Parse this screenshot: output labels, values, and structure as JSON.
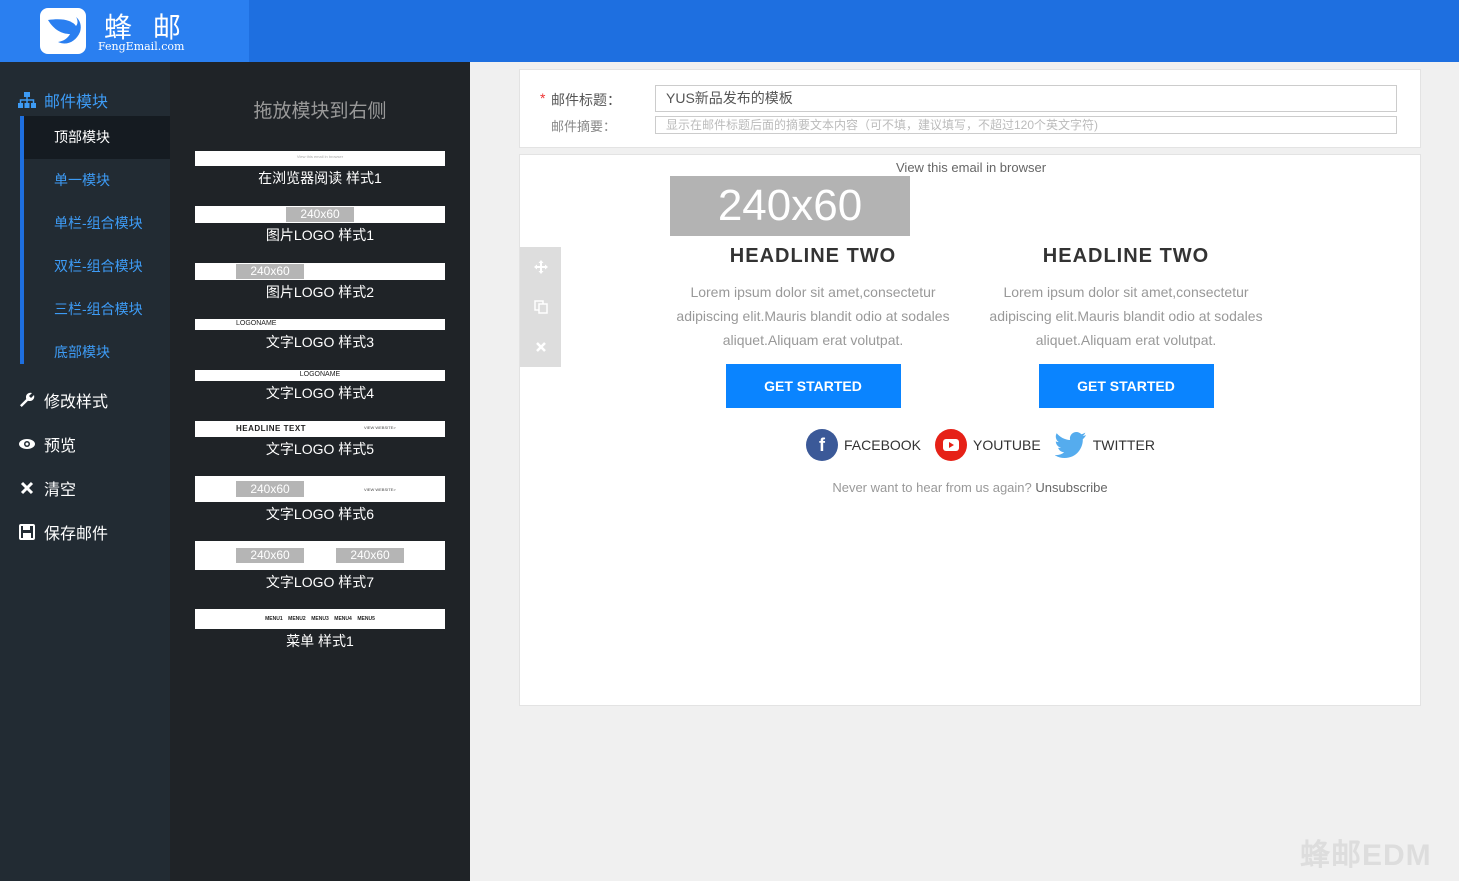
{
  "brand": {
    "name_cn": "蜂 邮",
    "name_en": "FengEmail.com"
  },
  "sidebar": {
    "section_label": "邮件模块",
    "sub_items": [
      {
        "label": "顶部模块",
        "active": true
      },
      {
        "label": "单一模块",
        "active": false
      },
      {
        "label": "单栏-组合模块",
        "active": false
      },
      {
        "label": "双栏-组合模块",
        "active": false
      },
      {
        "label": "三栏-组合模块",
        "active": false
      },
      {
        "label": "底部模块",
        "active": false
      }
    ],
    "actions": [
      {
        "label": "修改样式",
        "icon": "wrench-icon"
      },
      {
        "label": "预览",
        "icon": "eye-icon"
      },
      {
        "label": "清空",
        "icon": "close-icon"
      },
      {
        "label": "保存邮件",
        "icon": "save-icon"
      }
    ]
  },
  "modules": {
    "title": "拖放模块到右侧",
    "items": [
      {
        "caption": "在浏览器阅读 样式1",
        "preview_text": "View this email in browser"
      },
      {
        "caption": "图片LOGO 样式1",
        "preview_text": "240x60"
      },
      {
        "caption": "图片LOGO 样式2",
        "preview_text": "240x60"
      },
      {
        "caption": "文字LOGO 样式3",
        "preview_text": "LOGONAME"
      },
      {
        "caption": "文字LOGO 样式4",
        "preview_text": "LOGONAME"
      },
      {
        "caption": "文字LOGO 样式5",
        "preview_text": "HEADLINE TEXT",
        "preview_text_2": "VIEW WEBSITE>"
      },
      {
        "caption": "文字LOGO 样式6",
        "preview_text": "240x60",
        "preview_text_2": "VIEW WEBSITE>"
      },
      {
        "caption": "文字LOGO 样式7",
        "preview_text": "240x60",
        "preview_text_2": "240x60"
      },
      {
        "caption": "菜单 样式1",
        "preview_text": "MENU1    MENU2    MENU3    MENU4    MENU5"
      }
    ]
  },
  "form": {
    "required_mark": "*",
    "subject_label": "邮件标题：",
    "subject_value": "YUS新品发布的模板",
    "summary_label": "邮件摘要：",
    "summary_placeholder": "显示在邮件标题后面的摘要文本内容（可不填，建议填写，不超过120个英文字符)"
  },
  "email": {
    "view_in_browser": "View this email in browser",
    "logo_placeholder": "240x60",
    "columns": [
      {
        "headline": "HEADLINE TWO",
        "body": "Lorem ipsum dolor sit amet,consectetur adipiscing elit.Mauris blandit odio at sodales aliquet.Aliquam erat volutpat.",
        "cta": "GET STARTED"
      },
      {
        "headline": "HEADLINE TWO",
        "body": "Lorem ipsum dolor sit amet,consectetur adipiscing elit.Mauris blandit odio at sodales aliquet.Aliquam erat volutpat.",
        "cta": "GET STARTED"
      }
    ],
    "social": [
      {
        "label": "FACEBOOK",
        "icon": "facebook-icon",
        "color": "#3b5998"
      },
      {
        "label": "YOUTUBE",
        "icon": "youtube-icon",
        "color": "#e62117"
      },
      {
        "label": "TWITTER",
        "icon": "twitter-icon",
        "color": "#55acee"
      }
    ],
    "unsubscribe_prefix": "Never want to hear from us again?",
    "unsubscribe_link": "Unsubscribe"
  },
  "watermark": "蜂邮EDM",
  "colors": {
    "topbar": "#1e6fe0",
    "accent": "#0a84ff",
    "sidebar_bg": "#222b33"
  }
}
